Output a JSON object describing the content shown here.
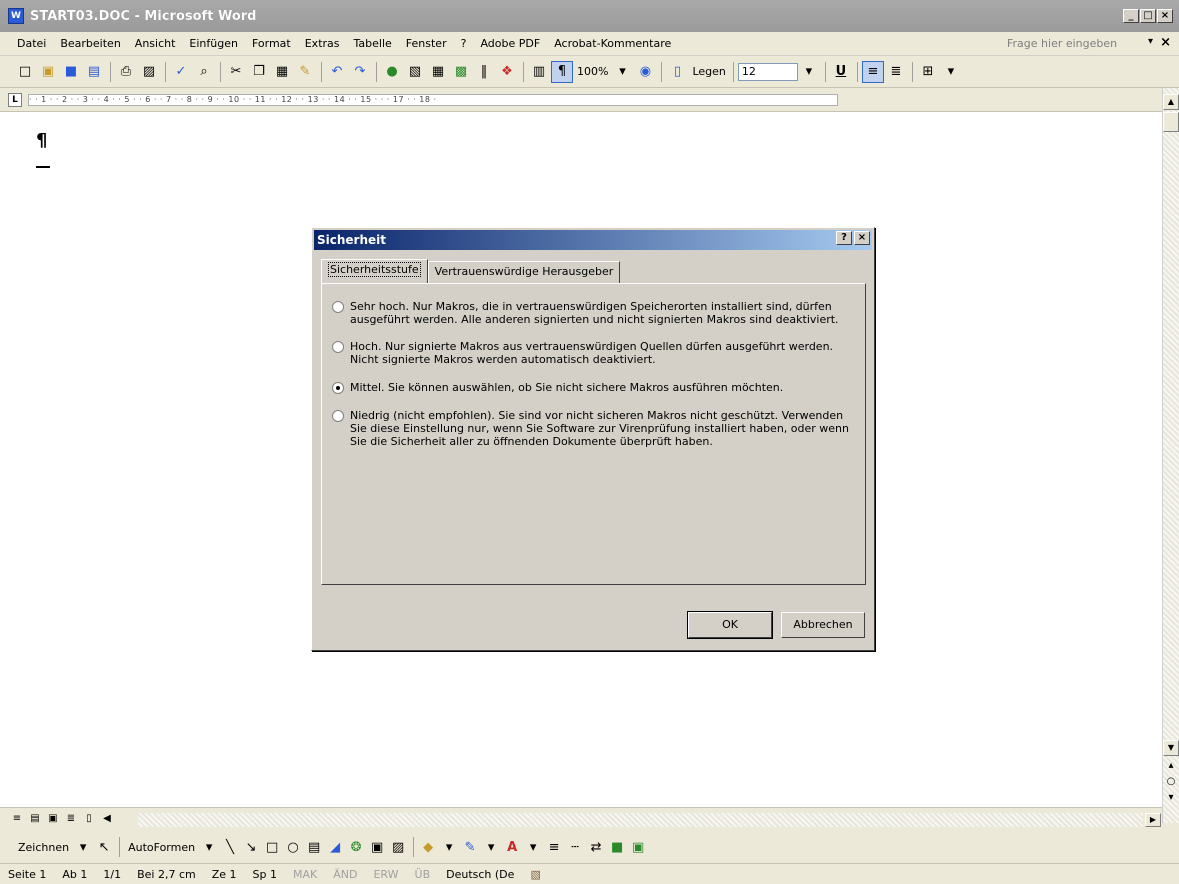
{
  "window": {
    "title": "START03.DOC - Microsoft Word",
    "app_icon_text": "W",
    "min_label": "_",
    "max_label": "²",
    "close_label": "×"
  },
  "menubar": {
    "items": [
      "Datei",
      "Bearbeiten",
      "Ansicht",
      "Einfügen",
      "Format",
      "Extras",
      "Tabelle",
      "Fenster",
      "?",
      "Adobe PDF",
      "Acrobat-Kommentare"
    ],
    "help_placeholder": "Frage hier eingeben",
    "close_doc_label": "×",
    "dropdown_label": "▾"
  },
  "toolbar": {
    "zoom": "100%",
    "read_label": "Legen",
    "font_size": "12",
    "bold_label": "U"
  },
  "ruler": {
    "numbers": "· · 1 · · 2 · · 3 · · 4 · · 5 · · 6 · · 7 · · 8 · · 9 · · 10 · · 11 · · 12 · · 13 · · 14 · · 15 · · · 17 · · 18 ·",
    "tab_stop_label": "L"
  },
  "document": {
    "pilcrow": "¶"
  },
  "dialog": {
    "title": "Sicherheit",
    "help_label": "?",
    "close_label": "×",
    "tabs": [
      {
        "label": "Sicherheitsstufe"
      },
      {
        "label": "Vertrauenswürdige Herausgeber"
      }
    ],
    "options": [
      {
        "text": "Sehr hoch. Nur Makros, die in vertrauenswürdigen Speicherorten installiert sind, dürfen ausgeführt werden. Alle anderen signierten und nicht signierten Makros sind deaktiviert.",
        "checked": false
      },
      {
        "text": "Hoch. Nur signierte Makros aus vertrauenswürdigen Quellen dürfen ausgeführt werden. Nicht signierte Makros werden automatisch deaktiviert.",
        "checked": false
      },
      {
        "text": "Mittel. Sie können auswählen, ob Sie nicht sichere Makros ausführen möchten.",
        "checked": true
      },
      {
        "text": "Niedrig (nicht empfohlen). Sie sind vor nicht sicheren Makros nicht geschützt. Verwenden Sie diese Einstellung nur, wenn Sie Software zur Virenprüfung installiert haben, oder wenn Sie die Sicherheit aller zu öffnenden Dokumente überprüft haben.",
        "checked": false
      }
    ],
    "ok_label": "OK",
    "cancel_label": "Abbrechen"
  },
  "drawbar": {
    "draw_label": "Zeichnen",
    "autoshapes_label": "AutoFormen"
  },
  "statusbar": {
    "page": "Seite 1",
    "section": "Ab 1",
    "pages": "1/1",
    "position": "Bei 2,7 cm",
    "line": "Ze 1",
    "column": "Sp 1",
    "rec": "MAK",
    "trk": "ÄND",
    "ext": "ERW",
    "ovr": "ÜB",
    "language": "Deutsch (De"
  }
}
